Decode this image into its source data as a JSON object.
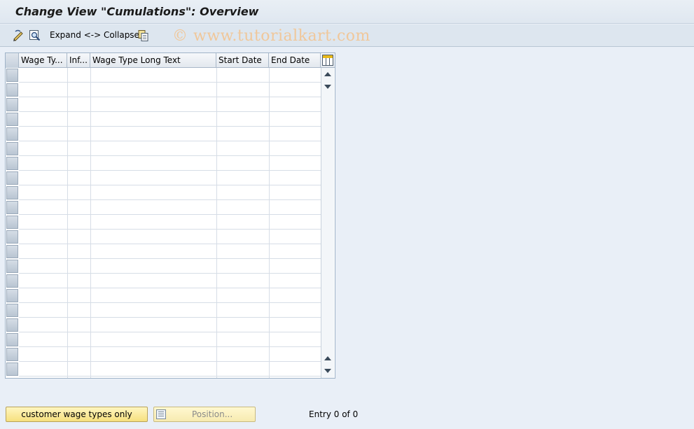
{
  "title": "Change View \"Cumulations\": Overview",
  "toolbar": {
    "expand_collapse_label": "Expand <-> Collapse",
    "watermark": "© www.tutorialkart.com"
  },
  "table": {
    "columns": [
      {
        "label": "Wage Ty..."
      },
      {
        "label": "Inf..."
      },
      {
        "label": "Wage Type Long Text"
      },
      {
        "label": "Start Date"
      },
      {
        "label": "End Date"
      }
    ],
    "rows": []
  },
  "buttons": {
    "customer_wage_types": "customer wage types only",
    "position": "Position..."
  },
  "status": {
    "entry": "Entry 0 of 0"
  }
}
